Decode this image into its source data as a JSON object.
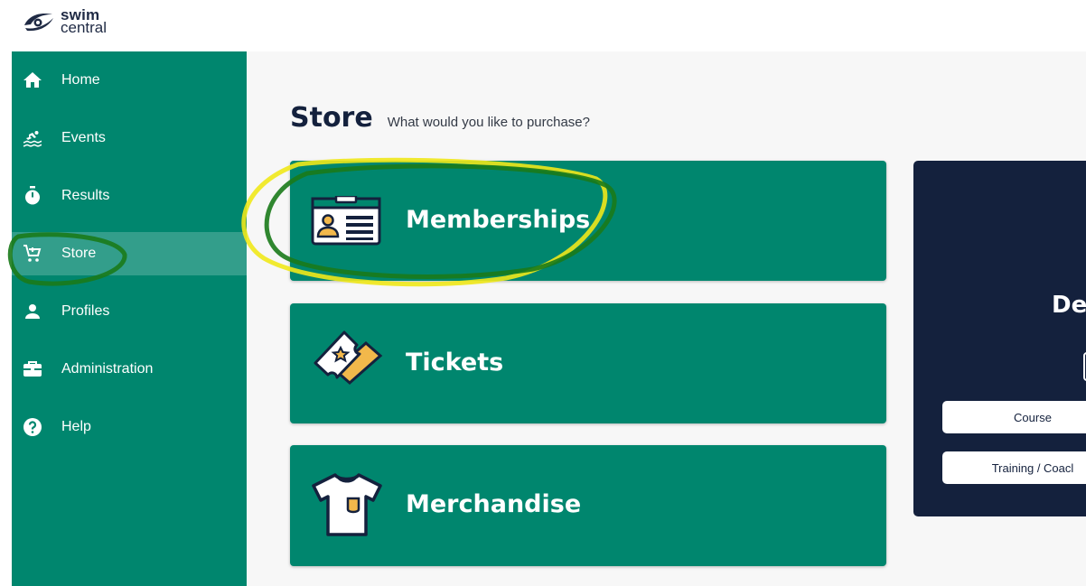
{
  "app": {
    "logo_line1": "swim",
    "logo_line2": "central"
  },
  "sidebar": {
    "items": [
      {
        "label": "Home",
        "icon": "home-icon"
      },
      {
        "label": "Events",
        "icon": "swimmer-icon"
      },
      {
        "label": "Results",
        "icon": "stopwatch-icon"
      },
      {
        "label": "Store",
        "icon": "cart-icon",
        "active": true
      },
      {
        "label": "Profiles",
        "icon": "person-icon"
      },
      {
        "label": "Administration",
        "icon": "briefcase-icon"
      },
      {
        "label": "Help",
        "icon": "help-icon"
      }
    ]
  },
  "main": {
    "title": "Store",
    "subtitle": "What would you like to purchase?",
    "cards": [
      {
        "label": "Memberships",
        "icon": "id-card-icon"
      },
      {
        "label": "Tickets",
        "icon": "ticket-icon"
      },
      {
        "label": "Merchandise",
        "icon": "tshirt-icon"
      }
    ]
  },
  "promo": {
    "title": "De",
    "buttons": [
      "Course",
      "Training / Coacl"
    ]
  },
  "colors": {
    "brand_green": "#00866e",
    "navy": "#14213d",
    "annotation_yellow": "#f0e81a",
    "annotation_green": "#1a7a1a"
  }
}
